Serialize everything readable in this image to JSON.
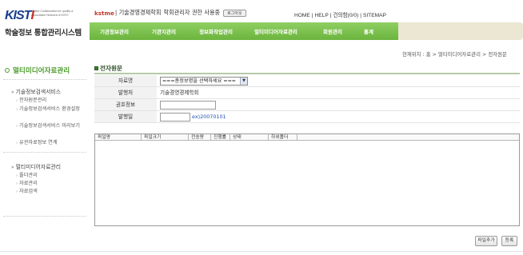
{
  "brand": {
    "logo_text": "KISTI",
    "tagline": "Online Collaboration for quality & Association Network of KISTI",
    "system_name": "학술정보 통합관리시스템"
  },
  "session": {
    "user_id": "kstme",
    "org_name": "| 기술경영경제학회",
    "role_text": "학회관리자 권한 사용중",
    "logout_label": "로그아웃"
  },
  "util_links": [
    "HOME",
    "HELP",
    "건의함(0/0)",
    "SITEMAP"
  ],
  "nav": {
    "items": [
      "기관정보관리",
      "기관지관리",
      "정보화작업관리",
      "멀티미디어자료관리",
      "회원관리",
      "통계"
    ]
  },
  "sidebar": {
    "title": "멀티미디어자료관리",
    "groups": [
      {
        "label": "기술정보검색서비스",
        "items": [
          "전자원문관리",
          "기술정보검색서비스 환경설정",
          "기술정보검색서비스 미리보기",
          "유관자료정보 연계"
        ]
      },
      {
        "label": "멀티미디어자료관리",
        "items": [
          "폴더관리",
          "자료관리",
          "자료검색"
        ]
      }
    ]
  },
  "breadcrumb": "현재위치 : 홈 > 멀티미디어자료관리 > 전자원문",
  "page_title": "전자원문",
  "form": {
    "journal_label": "자료명",
    "journal_select_value": "===총정보명을 선택하세요 ===",
    "publisher_label": "발행처",
    "publisher_value": "기술경영경제학회",
    "volume_label": "권호정보",
    "volume_value": "",
    "date_label": "발행일",
    "date_value": "",
    "date_hint": "ex)20070101"
  },
  "file_table": {
    "headers": [
      "파일명",
      "파일크기",
      "전송량",
      "진행률",
      "상태",
      "하위폴더"
    ]
  },
  "buttons": {
    "add_file": "파일추가",
    "register": "등록"
  }
}
